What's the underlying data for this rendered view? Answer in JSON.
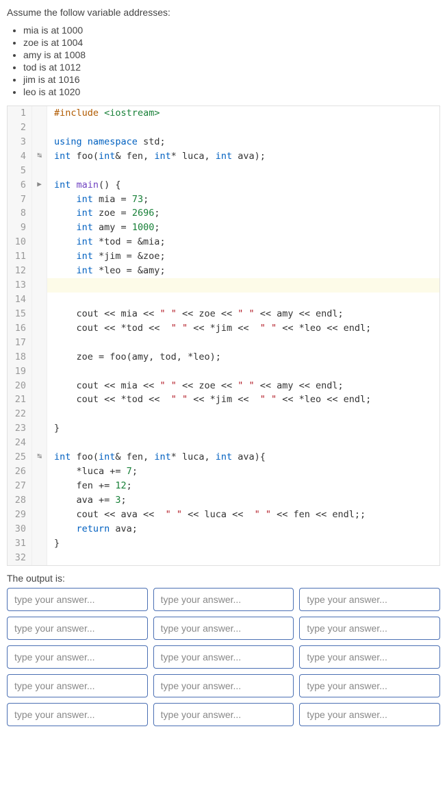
{
  "intro": "Assume the follow variable addresses:",
  "addresses": [
    "mia is at 1000",
    "zoe is at 1004",
    "amy is at 1008",
    "tod is at 1012",
    "jim is at 1016",
    "leo is at 1020"
  ],
  "code": [
    {
      "n": 1,
      "marker": "",
      "hl": false,
      "segs": [
        [
          "pp",
          "#include"
        ],
        [
          "",
          " "
        ],
        [
          "inc",
          "<iostream>"
        ]
      ]
    },
    {
      "n": 2,
      "marker": "",
      "hl": false,
      "segs": []
    },
    {
      "n": 3,
      "marker": "",
      "hl": false,
      "segs": [
        [
          "kw",
          "using"
        ],
        [
          "",
          " "
        ],
        [
          "kw",
          "namespace"
        ],
        [
          "",
          " std;"
        ]
      ]
    },
    {
      "n": 4,
      "marker": "↹",
      "hl": false,
      "segs": [
        [
          "type",
          "int"
        ],
        [
          "",
          " foo("
        ],
        [
          "type",
          "int"
        ],
        [
          "",
          "& fen, "
        ],
        [
          "type",
          "int"
        ],
        [
          "",
          "* luca, "
        ],
        [
          "type",
          "int"
        ],
        [
          "",
          " ava);"
        ]
      ]
    },
    {
      "n": 5,
      "marker": "",
      "hl": false,
      "segs": []
    },
    {
      "n": 6,
      "marker": "▶",
      "hl": false,
      "segs": [
        [
          "type",
          "int"
        ],
        [
          "",
          " "
        ],
        [
          "fn",
          "main"
        ],
        [
          "",
          "() {"
        ]
      ]
    },
    {
      "n": 7,
      "marker": "",
      "hl": false,
      "segs": [
        [
          "",
          "    "
        ],
        [
          "type",
          "int"
        ],
        [
          "",
          " mia = "
        ],
        [
          "num",
          "73"
        ],
        [
          "",
          ";"
        ]
      ]
    },
    {
      "n": 8,
      "marker": "",
      "hl": false,
      "segs": [
        [
          "",
          "    "
        ],
        [
          "type",
          "int"
        ],
        [
          "",
          " zoe = "
        ],
        [
          "num",
          "2696"
        ],
        [
          "",
          ";"
        ]
      ]
    },
    {
      "n": 9,
      "marker": "",
      "hl": false,
      "segs": [
        [
          "",
          "    "
        ],
        [
          "type",
          "int"
        ],
        [
          "",
          " amy = "
        ],
        [
          "num",
          "1000"
        ],
        [
          "",
          ";"
        ]
      ]
    },
    {
      "n": 10,
      "marker": "",
      "hl": false,
      "segs": [
        [
          "",
          "    "
        ],
        [
          "type",
          "int"
        ],
        [
          "",
          " *tod = &mia;"
        ]
      ]
    },
    {
      "n": 11,
      "marker": "",
      "hl": false,
      "segs": [
        [
          "",
          "    "
        ],
        [
          "type",
          "int"
        ],
        [
          "",
          " *jim = &zoe;"
        ]
      ]
    },
    {
      "n": 12,
      "marker": "",
      "hl": false,
      "segs": [
        [
          "",
          "    "
        ],
        [
          "type",
          "int"
        ],
        [
          "",
          " *leo = &amy;"
        ]
      ]
    },
    {
      "n": 13,
      "marker": "",
      "hl": true,
      "segs": []
    },
    {
      "n": 14,
      "marker": "",
      "hl": false,
      "segs": []
    },
    {
      "n": 15,
      "marker": "",
      "hl": false,
      "segs": [
        [
          "",
          "    cout << mia << "
        ],
        [
          "str",
          "\" \""
        ],
        [
          "",
          " << zoe << "
        ],
        [
          "str",
          "\" \""
        ],
        [
          "",
          " << amy << endl;"
        ]
      ]
    },
    {
      "n": 16,
      "marker": "",
      "hl": false,
      "segs": [
        [
          "",
          "    cout << *tod <<  "
        ],
        [
          "str",
          "\" \""
        ],
        [
          "",
          " << *jim <<  "
        ],
        [
          "str",
          "\" \""
        ],
        [
          "",
          " << *leo << endl;"
        ]
      ]
    },
    {
      "n": 17,
      "marker": "",
      "hl": false,
      "segs": []
    },
    {
      "n": 18,
      "marker": "",
      "hl": false,
      "segs": [
        [
          "",
          "    zoe = foo(amy, tod, *leo);"
        ]
      ]
    },
    {
      "n": 19,
      "marker": "",
      "hl": false,
      "segs": []
    },
    {
      "n": 20,
      "marker": "",
      "hl": false,
      "segs": [
        [
          "",
          "    cout << mia << "
        ],
        [
          "str",
          "\" \""
        ],
        [
          "",
          " << zoe << "
        ],
        [
          "str",
          "\" \""
        ],
        [
          "",
          " << amy << endl;"
        ]
      ]
    },
    {
      "n": 21,
      "marker": "",
      "hl": false,
      "segs": [
        [
          "",
          "    cout << *tod <<  "
        ],
        [
          "str",
          "\" \""
        ],
        [
          "",
          " << *jim <<  "
        ],
        [
          "str",
          "\" \""
        ],
        [
          "",
          " << *leo << endl;"
        ]
      ]
    },
    {
      "n": 22,
      "marker": "",
      "hl": false,
      "segs": []
    },
    {
      "n": 23,
      "marker": "",
      "hl": false,
      "segs": [
        [
          "",
          "}"
        ]
      ]
    },
    {
      "n": 24,
      "marker": "",
      "hl": false,
      "segs": []
    },
    {
      "n": 25,
      "marker": "↹",
      "hl": false,
      "segs": [
        [
          "type",
          "int"
        ],
        [
          "",
          " foo("
        ],
        [
          "type",
          "int"
        ],
        [
          "",
          "& fen, "
        ],
        [
          "type",
          "int"
        ],
        [
          "",
          "* luca, "
        ],
        [
          "type",
          "int"
        ],
        [
          "",
          " ava){"
        ]
      ]
    },
    {
      "n": 26,
      "marker": "",
      "hl": false,
      "segs": [
        [
          "",
          "    *luca += "
        ],
        [
          "num",
          "7"
        ],
        [
          "",
          ";"
        ]
      ]
    },
    {
      "n": 27,
      "marker": "",
      "hl": false,
      "segs": [
        [
          "",
          "    fen += "
        ],
        [
          "num",
          "12"
        ],
        [
          "",
          ";"
        ]
      ]
    },
    {
      "n": 28,
      "marker": "",
      "hl": false,
      "segs": [
        [
          "",
          "    ava += "
        ],
        [
          "num",
          "3"
        ],
        [
          "",
          ";"
        ]
      ]
    },
    {
      "n": 29,
      "marker": "",
      "hl": false,
      "segs": [
        [
          "",
          "    cout << ava <<  "
        ],
        [
          "str",
          "\" \""
        ],
        [
          "",
          " << luca <<  "
        ],
        [
          "str",
          "\" \""
        ],
        [
          "",
          " << fen << endl;;"
        ]
      ]
    },
    {
      "n": 30,
      "marker": "",
      "hl": false,
      "segs": [
        [
          "",
          "    "
        ],
        [
          "kw",
          "return"
        ],
        [
          "",
          " ava;"
        ]
      ]
    },
    {
      "n": 31,
      "marker": "",
      "hl": false,
      "segs": [
        [
          "",
          "}"
        ]
      ]
    },
    {
      "n": 32,
      "marker": "",
      "hl": false,
      "segs": []
    }
  ],
  "output_label": "The output is:",
  "answers": {
    "placeholder": "type your answer...",
    "count": 15
  }
}
